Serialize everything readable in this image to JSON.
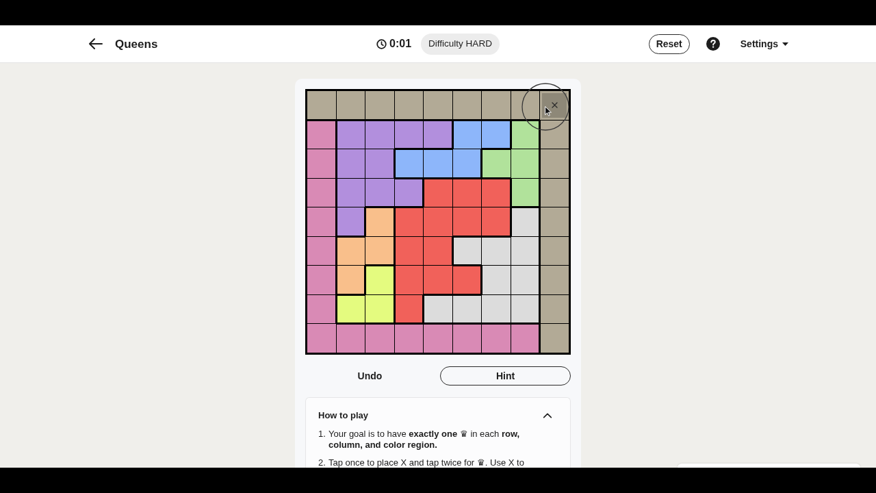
{
  "header": {
    "title": "Queens",
    "timer": "0:01",
    "difficulty": "Difficulty HARD",
    "reset_button": "Reset",
    "settings_menu": "Settings"
  },
  "board": {
    "rows": [
      [
        {
          "color": "#b2aa96",
          "x": false,
          "hovered": false
        },
        {
          "color": "#b2aa96",
          "x": false,
          "hovered": false
        },
        {
          "color": "#b2aa96",
          "x": false,
          "hovered": false
        },
        {
          "color": "#b2aa96",
          "x": false,
          "hovered": false
        },
        {
          "color": "#b2aa96",
          "x": false,
          "hovered": false
        },
        {
          "color": "#b2aa96",
          "x": false,
          "hovered": false
        },
        {
          "color": "#b2aa96",
          "x": false,
          "hovered": false
        },
        {
          "color": "#b2aa96",
          "x": false,
          "hovered": false
        },
        {
          "color": "#b2aa96",
          "x": true,
          "hovered": true
        }
      ],
      [
        {
          "color": "#d98ab5",
          "x": false,
          "hovered": false
        },
        {
          "color": "#b28fdd",
          "x": false,
          "hovered": false
        },
        {
          "color": "#b28fdd",
          "x": false,
          "hovered": false
        },
        {
          "color": "#b28fdd",
          "x": false,
          "hovered": false
        },
        {
          "color": "#b28fdd",
          "x": false,
          "hovered": false
        },
        {
          "color": "#8db6fa",
          "x": false,
          "hovered": false
        },
        {
          "color": "#8db6fa",
          "x": false,
          "hovered": false
        },
        {
          "color": "#b1e29b",
          "x": false,
          "hovered": false
        },
        {
          "color": "#b2aa96",
          "x": false,
          "hovered": false
        }
      ],
      [
        {
          "color": "#d98ab5",
          "x": false,
          "hovered": false
        },
        {
          "color": "#b28fdd",
          "x": false,
          "hovered": false
        },
        {
          "color": "#b28fdd",
          "x": false,
          "hovered": false
        },
        {
          "color": "#8db6fa",
          "x": false,
          "hovered": false
        },
        {
          "color": "#8db6fa",
          "x": false,
          "hovered": false
        },
        {
          "color": "#8db6fa",
          "x": false,
          "hovered": false
        },
        {
          "color": "#b1e29b",
          "x": false,
          "hovered": false
        },
        {
          "color": "#b1e29b",
          "x": false,
          "hovered": false
        },
        {
          "color": "#b2aa96",
          "x": false,
          "hovered": false
        }
      ],
      [
        {
          "color": "#d98ab5",
          "x": false,
          "hovered": false
        },
        {
          "color": "#b28fdd",
          "x": false,
          "hovered": false
        },
        {
          "color": "#b28fdd",
          "x": false,
          "hovered": false
        },
        {
          "color": "#b28fdd",
          "x": false,
          "hovered": false
        },
        {
          "color": "#f1615a",
          "x": false,
          "hovered": false
        },
        {
          "color": "#f1615a",
          "x": false,
          "hovered": false
        },
        {
          "color": "#f1615a",
          "x": false,
          "hovered": false
        },
        {
          "color": "#b1e29b",
          "x": false,
          "hovered": false
        },
        {
          "color": "#b2aa96",
          "x": false,
          "hovered": false
        }
      ],
      [
        {
          "color": "#d98ab5",
          "x": false,
          "hovered": false
        },
        {
          "color": "#b28fdd",
          "x": false,
          "hovered": false
        },
        {
          "color": "#f9bf8b",
          "x": false,
          "hovered": false
        },
        {
          "color": "#f1615a",
          "x": false,
          "hovered": false
        },
        {
          "color": "#f1615a",
          "x": false,
          "hovered": false
        },
        {
          "color": "#f1615a",
          "x": false,
          "hovered": false
        },
        {
          "color": "#f1615a",
          "x": false,
          "hovered": false
        },
        {
          "color": "#dcdcdc",
          "x": false,
          "hovered": false
        },
        {
          "color": "#b2aa96",
          "x": false,
          "hovered": false
        }
      ],
      [
        {
          "color": "#d98ab5",
          "x": false,
          "hovered": false
        },
        {
          "color": "#f9bf8b",
          "x": false,
          "hovered": false
        },
        {
          "color": "#f9bf8b",
          "x": false,
          "hovered": false
        },
        {
          "color": "#f1615a",
          "x": false,
          "hovered": false
        },
        {
          "color": "#f1615a",
          "x": false,
          "hovered": false
        },
        {
          "color": "#dcdcdc",
          "x": false,
          "hovered": false
        },
        {
          "color": "#dcdcdc",
          "x": false,
          "hovered": false
        },
        {
          "color": "#dcdcdc",
          "x": false,
          "hovered": false
        },
        {
          "color": "#b2aa96",
          "x": false,
          "hovered": false
        }
      ],
      [
        {
          "color": "#d98ab5",
          "x": false,
          "hovered": false
        },
        {
          "color": "#f9bf8b",
          "x": false,
          "hovered": false
        },
        {
          "color": "#e4fb7f",
          "x": false,
          "hovered": false
        },
        {
          "color": "#f1615a",
          "x": false,
          "hovered": false
        },
        {
          "color": "#f1615a",
          "x": false,
          "hovered": false
        },
        {
          "color": "#f1615a",
          "x": false,
          "hovered": false
        },
        {
          "color": "#dcdcdc",
          "x": false,
          "hovered": false
        },
        {
          "color": "#dcdcdc",
          "x": false,
          "hovered": false
        },
        {
          "color": "#b2aa96",
          "x": false,
          "hovered": false
        }
      ],
      [
        {
          "color": "#d98ab5",
          "x": false,
          "hovered": false
        },
        {
          "color": "#e4fb7f",
          "x": false,
          "hovered": false
        },
        {
          "color": "#e4fb7f",
          "x": false,
          "hovered": false
        },
        {
          "color": "#f1615a",
          "x": false,
          "hovered": false
        },
        {
          "color": "#dcdcdc",
          "x": false,
          "hovered": false
        },
        {
          "color": "#dcdcdc",
          "x": false,
          "hovered": false
        },
        {
          "color": "#dcdcdc",
          "x": false,
          "hovered": false
        },
        {
          "color": "#dcdcdc",
          "x": false,
          "hovered": false
        },
        {
          "color": "#b2aa96",
          "x": false,
          "hovered": false
        }
      ],
      [
        {
          "color": "#d98ab5",
          "x": false,
          "hovered": false
        },
        {
          "color": "#d98ab5",
          "x": false,
          "hovered": false
        },
        {
          "color": "#d98ab5",
          "x": false,
          "hovered": false
        },
        {
          "color": "#d98ab5",
          "x": false,
          "hovered": false
        },
        {
          "color": "#d98ab5",
          "x": false,
          "hovered": false
        },
        {
          "color": "#d98ab5",
          "x": false,
          "hovered": false
        },
        {
          "color": "#d98ab5",
          "x": false,
          "hovered": false
        },
        {
          "color": "#d98ab5",
          "x": false,
          "hovered": false
        },
        {
          "color": "#b2aa96",
          "x": false,
          "hovered": false
        }
      ]
    ]
  },
  "actions": {
    "undo": "Undo",
    "hint": "Hint"
  },
  "how_to_play": {
    "title": "How to play",
    "expanded": true,
    "steps": [
      {
        "number": "1.",
        "text": "Your goal is to have **exactly one** ♛ in each **row, column, and color region.**"
      },
      {
        "number": "2.",
        "text": "Tap once to place X and tap twice for ♛. Use X to"
      }
    ]
  }
}
